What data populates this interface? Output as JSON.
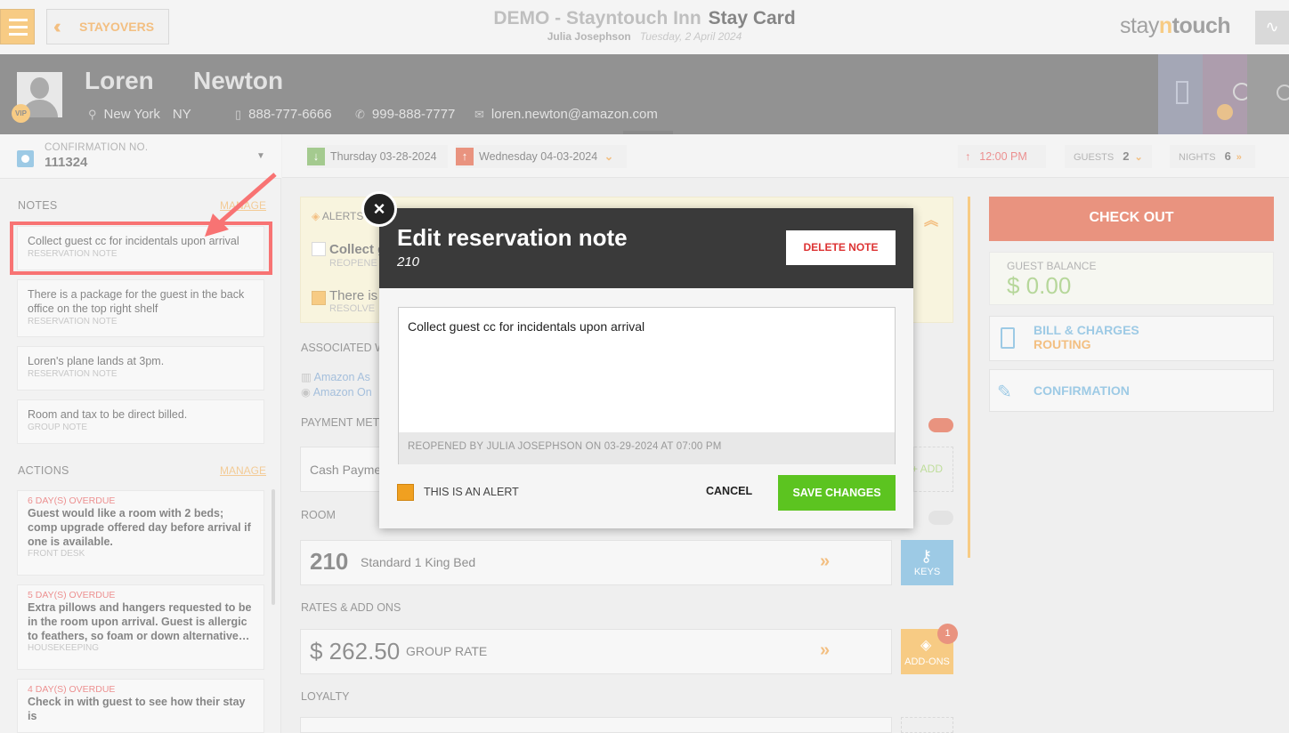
{
  "topbar": {
    "back_label": "STAYOVERS",
    "hotel_name": "DEMO - Stayntouch Inn",
    "page_title": "Stay Card",
    "user": "Julia Josephson",
    "date": "Tuesday, 2 April 2024",
    "logo_pre": "stay",
    "logo_n": "n",
    "logo_post": "touch"
  },
  "guest": {
    "first_name": "Loren",
    "last_name": "Newton",
    "vip": "VIP",
    "city": "New York",
    "state": "NY",
    "phone1": "888-777-6666",
    "phone2": "999-888-7777",
    "email": "loren.newton@amazon.com"
  },
  "confirmation": {
    "label": "CONFIRMATION NO.",
    "number": "111324"
  },
  "notes": {
    "title": "NOTES",
    "manage": "MANAGE",
    "items": [
      {
        "text": "Collect guest cc for incidentals upon arrival",
        "type": "RESERVATION NOTE"
      },
      {
        "text": "There is a package for the guest in the back office on the top right shelf",
        "type": "RESERVATION NOTE"
      },
      {
        "text": "Loren's plane lands at 3pm.",
        "type": "RESERVATION NOTE"
      },
      {
        "text": "Room and tax to be direct billed.",
        "type": "GROUP NOTE"
      }
    ]
  },
  "actions": {
    "title": "ACTIONS",
    "manage": "MANAGE",
    "items": [
      {
        "overdue": "6 DAY(S) OVERDUE",
        "text": "Guest would like a room with 2 beds; comp upgrade offered day before arrival if one is available.",
        "dept": "FRONT DESK"
      },
      {
        "overdue": "5 DAY(S) OVERDUE",
        "text": "Extra pillows and hangers requested to be in the room upon arrival. Guest is allergic to feathers, so foam or down alternative…",
        "dept": "HOUSEKEEPING"
      },
      {
        "overdue": "4 DAY(S) OVERDUE",
        "text": "Check in with guest to see how their stay is",
        "dept": ""
      }
    ]
  },
  "dates": {
    "arrival": "Thursday 03-28-2024",
    "departure": "Wednesday 04-03-2024",
    "time": "12:00 PM",
    "guests_label": "GUESTS",
    "guests": "2",
    "nights_label": "NIGHTS",
    "nights": "6"
  },
  "middle": {
    "alerts_label": "ALERTS",
    "alert1": "Collect g",
    "alert1_sub": "REOPENE",
    "alert2": "There is",
    "alert2_sub": "RESOLVE",
    "associated": "ASSOCIATED W",
    "assoc1": "Amazon As",
    "assoc2": "Amazon On",
    "payment": "PAYMENT METH",
    "payment_value": "Cash Payme",
    "add": "+ ADD",
    "room_label": "ROOM",
    "room_no": "210",
    "room_type": "Standard 1 King Bed",
    "keys": "KEYS",
    "rates_label": "RATES & ADD ONS",
    "rate": "$ 262.50",
    "rate_type": "GROUP RATE",
    "addons": "ADD-ONS",
    "addons_count": "1",
    "loyalty": "LOYALTY"
  },
  "right": {
    "checkout": "CHECK OUT",
    "balance_label": "GUEST BALANCE",
    "balance": "$ 0.00",
    "bill_line1": "BILL & CHARGES",
    "bill_line2": "ROUTING",
    "confirmation": "CONFIRMATION"
  },
  "modal": {
    "title": "Edit reservation note",
    "room": "210",
    "delete": "DELETE NOTE",
    "note_text": "Collect guest cc for incidentals upon arrival",
    "note_meta": "REOPENED BY JULIA JOSEPHSON ON 03-29-2024 AT 07:00 PM",
    "alert_label": "THIS IS AN ALERT",
    "cancel": "CANCEL",
    "save": "SAVE CHANGES"
  }
}
